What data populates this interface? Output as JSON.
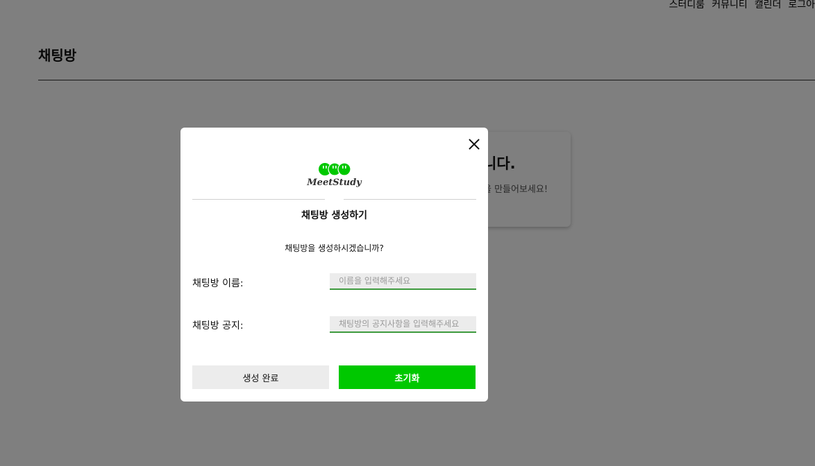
{
  "nav": {
    "items": [
      "스터디룸",
      "커뮤니티",
      "캘린더",
      "로그아"
    ]
  },
  "page": {
    "title": "채팅방",
    "empty_title": "니다.",
    "empty_subtitle": "을 만들어보세요!"
  },
  "modal": {
    "logo_text": "MeetStudy",
    "title": "채팅방 생성하기",
    "question": "채팅방을 생성하시겠습니까?",
    "name_label": "채팅방 이름:",
    "name_placeholder": "이름을 입력해주세요",
    "notice_label": "채팅방 공지:",
    "notice_placeholder": "채팅방의 공지사항을 입력해주세요",
    "submit_label": "생성 완료",
    "reset_label": "초기화"
  },
  "colors": {
    "accent": "#00c800",
    "input_underline": "#3e9a3e",
    "overlay": "rgba(0,0,0,0.5)"
  },
  "icons": {
    "close": "close-icon",
    "logo": "meetstudy-logo-icon"
  }
}
